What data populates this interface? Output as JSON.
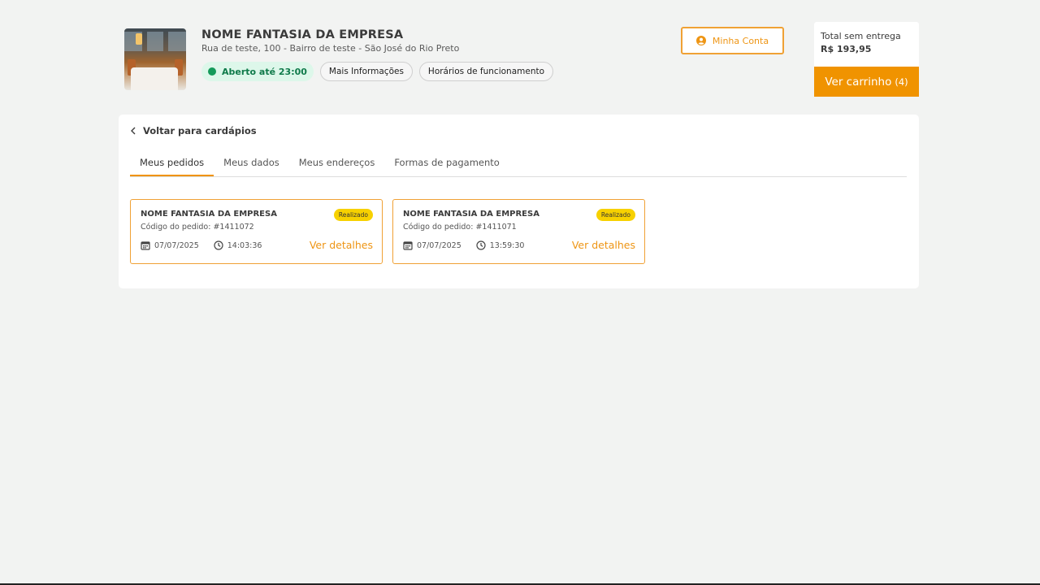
{
  "company": {
    "name": "NOME FANTASIA DA EMPRESA",
    "address": "Rua de teste, 100 - Bairro de teste - São José do Rio Preto",
    "open_status": "Aberto até 23:00",
    "more_info_label": "Mais Informações",
    "hours_label": "Horários de funcionamento"
  },
  "header": {
    "account_label": "Minha Conta"
  },
  "cart": {
    "label": "Total sem entrega",
    "total": "R$ 193,95",
    "button_label": "Ver carrinho",
    "count": "(4)"
  },
  "nav": {
    "back_label": "Voltar para cardápios"
  },
  "tabs": [
    {
      "label": "Meus pedidos",
      "active": true
    },
    {
      "label": "Meus dados",
      "active": false
    },
    {
      "label": "Meus endereços",
      "active": false
    },
    {
      "label": "Formas de pagamento",
      "active": false
    }
  ],
  "orders": [
    {
      "company": "NOME FANTASIA DA EMPRESA",
      "status": "Realizado",
      "code": "Código do pedido: #1411072",
      "date": "07/07/2025",
      "time": "14:03:36",
      "details_label": "Ver detalhes"
    },
    {
      "company": "NOME FANTASIA DA EMPRESA",
      "status": "Realizado",
      "code": "Código do pedido: #1411071",
      "date": "07/07/2025",
      "time": "13:59:30",
      "details_label": "Ver detalhes"
    }
  ],
  "colors": {
    "accent": "#f09300",
    "open_green": "#149a5a",
    "status_yellow": "#f7d100",
    "background": "#f2f3f2"
  },
  "icons": {
    "account": "user-circle-icon",
    "back": "chevron-left-icon",
    "date": "calendar-icon",
    "time": "clock-icon",
    "open": "status-dot-icon"
  }
}
